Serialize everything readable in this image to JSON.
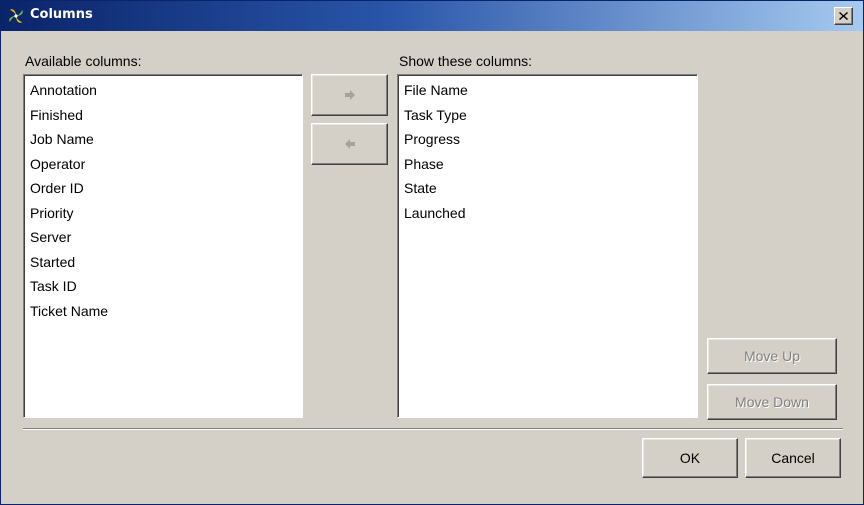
{
  "window": {
    "title": "Columns"
  },
  "available": {
    "label": "Available columns:",
    "items": [
      "Annotation",
      "Finished",
      "Job Name",
      "Operator",
      "Order ID",
      "Priority",
      "Server",
      "Started",
      "Task ID",
      "Ticket Name"
    ]
  },
  "shown": {
    "label": "Show these columns:",
    "items": [
      "File Name",
      "Task Type",
      "Progress",
      "Phase",
      "State",
      "Launched"
    ]
  },
  "buttons": {
    "move_up": "Move Up",
    "move_down": "Move Down",
    "ok": "OK",
    "cancel": "Cancel"
  },
  "icons": {
    "title": "app-logo-icon",
    "close": "close-icon",
    "add": "arrow-right-icon",
    "remove": "arrow-left-icon"
  }
}
